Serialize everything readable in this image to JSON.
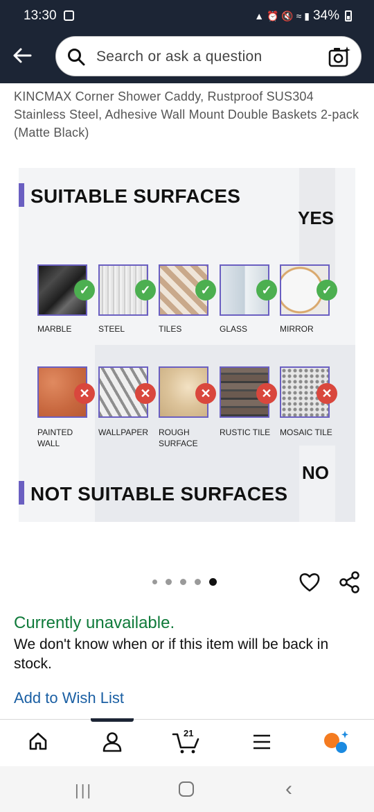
{
  "status_bar": {
    "time": "13:30",
    "battery": "34%"
  },
  "search": {
    "placeholder": "Search or ask a question"
  },
  "product": {
    "title": "KINCMAX Corner Shower Caddy, Rustproof SUS304 Stainless Steel, Adhesive Wall Mount Double Baskets 2-pack (Matte Black)"
  },
  "image": {
    "suitable_heading": "SUITABLE SURFACES",
    "yes_label": "YES",
    "no_label": "NO",
    "not_suitable_heading": "NOT SUITABLE SURFACES",
    "suitable": [
      {
        "label": "MARBLE",
        "icon": "check-icon"
      },
      {
        "label": "STEEL",
        "icon": "check-icon"
      },
      {
        "label": "TILES",
        "icon": "check-icon"
      },
      {
        "label": "GLASS",
        "icon": "check-icon"
      },
      {
        "label": "MIRROR",
        "icon": "check-icon"
      }
    ],
    "not_suitable": [
      {
        "label": "PAINTED\nWALL",
        "icon": "cross-icon"
      },
      {
        "label": "WALLPAPER",
        "icon": "cross-icon"
      },
      {
        "label": "ROUGH\nSURFACE",
        "icon": "cross-icon"
      },
      {
        "label": "RUSTIC TILE",
        "icon": "cross-icon"
      },
      {
        "label": "MOSAIC TILE",
        "icon": "cross-icon"
      }
    ],
    "carousel": {
      "total": 5,
      "active_index": 4
    }
  },
  "availability": {
    "status": "Currently unavailable.",
    "note": "We don't know when or if this item will be back in stock."
  },
  "wishlist": {
    "link": "Add to Wish List"
  },
  "bottom_nav": {
    "cart_count": "21"
  },
  "colors": {
    "header_bg": "#1c2535",
    "accent": "#6a5fc1",
    "available_green": "#0f7a3a",
    "link_blue": "#1a5fa3",
    "check_green": "#4caf50",
    "cross_red": "#d9473d"
  }
}
